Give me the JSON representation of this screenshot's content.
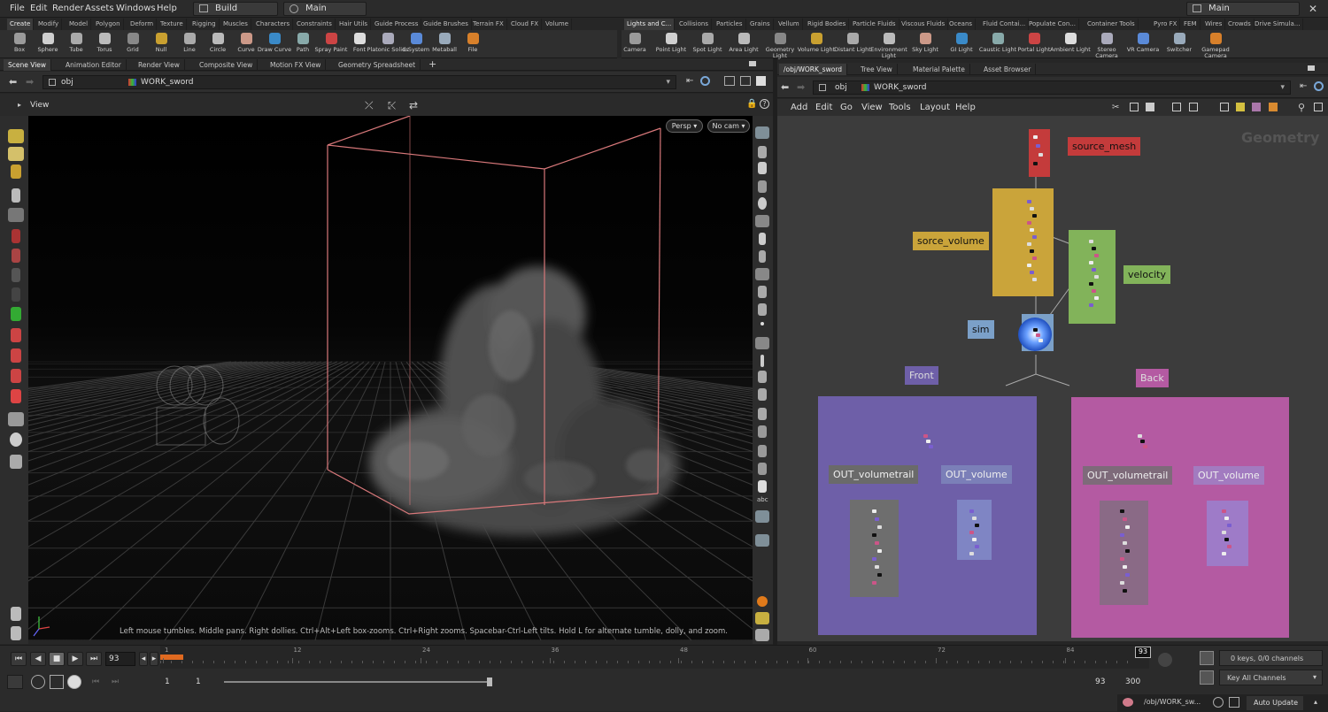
{
  "menubar": {
    "items": [
      "File",
      "Edit",
      "Render",
      "Assets",
      "Windows",
      "Help"
    ],
    "desktop": "Build",
    "context": "Main",
    "right_context": "Main"
  },
  "shelf_left": {
    "tabs": [
      "Create",
      "Modify",
      "Model",
      "Polygon",
      "Deform",
      "Texture",
      "Rigging",
      "Muscles",
      "Characters",
      "Constraints",
      "Hair Utils",
      "Guide Process",
      "Guide Brushes",
      "Terrain FX",
      "Cloud FX",
      "Volume"
    ],
    "tools": [
      "Box",
      "Sphere",
      "Tube",
      "Torus",
      "Grid",
      "Null",
      "Line",
      "Circle",
      "Curve",
      "Draw Curve",
      "Path",
      "Spray Paint",
      "Font",
      "Platonic Solids",
      "L-System",
      "Metaball",
      "File"
    ]
  },
  "shelf_right": {
    "tabs": [
      "Lights and C...",
      "Collisions",
      "Particles",
      "Grains",
      "Vellum",
      "Rigid Bodies",
      "Particle Fluids",
      "Viscous Fluids",
      "Oceans",
      "Fluid Contai...",
      "Populate Con...",
      "Container Tools",
      "Pyro FX",
      "FEM",
      "Wires",
      "Crowds",
      "Drive Simula..."
    ],
    "tools": [
      "Camera",
      "Point Light",
      "Spot Light",
      "Area Light",
      "Geometry Light",
      "Volume Light",
      "Distant Light",
      "Environment Light",
      "Sky Light",
      "GI Light",
      "Caustic Light",
      "Portal Light",
      "Ambient Light",
      "Stereo Camera",
      "VR Camera",
      "Switcher",
      "Gamepad Camera"
    ]
  },
  "left_panel": {
    "tabs": [
      "Scene View",
      "Animation Editor",
      "Render View",
      "Composite View",
      "Motion FX View",
      "Geometry Spreadsheet"
    ],
    "path_root": "obj",
    "path_node": "WORK_sword",
    "view_label": "View",
    "persp": "Persp ▾",
    "cam": "No cam ▾",
    "hint": "Left mouse tumbles. Middle pans. Right dollies. Ctrl+Alt+Left box-zooms. Ctrl+Right zooms. Spacebar-Ctrl-Left tilts. Hold L for alternate tumble, dolly, and zoom."
  },
  "right_panel": {
    "tabs": [
      "/obj/WORK_sword",
      "Tree View",
      "Material Palette",
      "Asset Browser"
    ],
    "path_root": "obj",
    "path_node": "WORK_sword",
    "menu": [
      "Add",
      "Edit",
      "Go",
      "View",
      "Tools",
      "Layout",
      "Help"
    ],
    "context_label": "Geometry",
    "labels": {
      "source_mesh": "source_mesh",
      "sorce_volume": "sorce_volume",
      "velocity": "velocity",
      "sim": "sim",
      "front": "Front",
      "back": "Back",
      "front_trail": "OUT_volumetrail",
      "front_vol": "OUT_volume",
      "back_trail": "OUT_volumetrail",
      "back_vol": "OUT_volume"
    },
    "colors": {
      "red": "#c43b3b",
      "yellow": "#caa43a",
      "green": "#82b35a",
      "blue": "#7ba0c8",
      "purple": "#6e5fa8",
      "pink": "#b45aa2"
    }
  },
  "timeline": {
    "current_frame": "93",
    "frame_marker": "93",
    "ticks": [
      "1",
      "12",
      "24",
      "36",
      "48",
      "60",
      "72",
      "84"
    ],
    "start": "1",
    "start2": "1",
    "end": "93",
    "end2": "300",
    "keys": "0 keys, 0/0 channels",
    "key_all": "Key All Channels",
    "path": "/obj/WORK_sw...",
    "auto_update": "Auto Update"
  }
}
